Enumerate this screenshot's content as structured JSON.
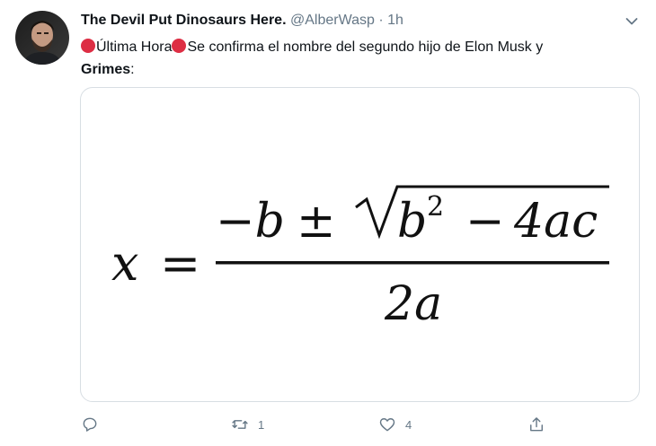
{
  "tweet": {
    "author_name": "The Devil Put Dinosaurs Here.",
    "handle": "@AlberWasp",
    "separator": "·",
    "time": "1h",
    "text": {
      "prefix": "Última Hora",
      "body": "Se confirma el nombre del segundo hijo de Elon Musk y",
      "bold": "Grimes",
      "suffix": ":"
    },
    "media": {
      "formula": {
        "x": "x",
        "eq": "=",
        "minus_b": "−b",
        "pm": "±",
        "b": "b",
        "sq": "2",
        "minus": "−",
        "four_ac": "4ac",
        "denominator": "2a"
      }
    },
    "actions": {
      "reply_icon": "reply-icon",
      "retweet_icon": "retweet-icon",
      "retweet_count": "1",
      "like_icon": "heart-icon",
      "like_count": "4",
      "share_icon": "share-icon"
    }
  },
  "colors": {
    "text_primary": "#0f1419",
    "text_secondary": "#657786",
    "emoji_red": "#dd2e44",
    "border": "#d8dee3"
  }
}
